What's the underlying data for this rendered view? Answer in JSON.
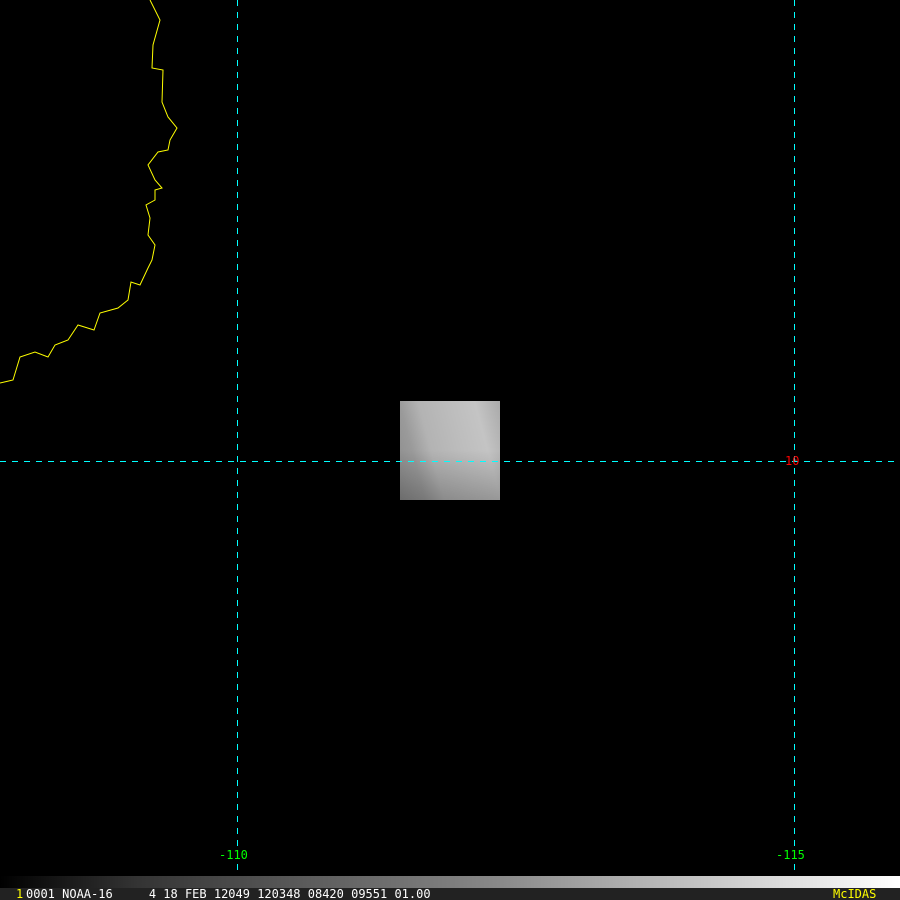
{
  "map": {
    "colors": {
      "grid": "#00ffff",
      "coast": "#ffff00",
      "lon_label": "#00ff00",
      "lat_label": "#ff0000",
      "brand": "#ffff00"
    },
    "lon_labels": [
      "-110",
      "-115"
    ],
    "lat_labels": [
      "10"
    ]
  },
  "status": {
    "frame": "1",
    "info": "0001 NOAA-16     4 18 FEB 12049 120348 08420 09551 01.00",
    "brand": "McIDAS"
  }
}
